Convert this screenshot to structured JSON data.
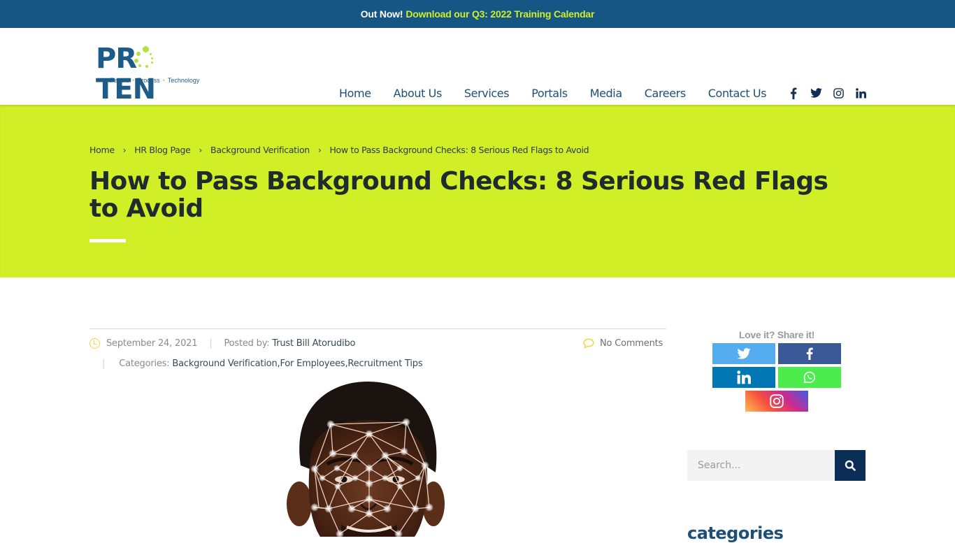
{
  "announcement": {
    "lead": "Out Now!",
    "link": "Download our Q3: 2022 Training Calendar"
  },
  "logo": {
    "wordmark_left": "PR",
    "wordmark_right": "TEN",
    "tagline": [
      "People",
      "Process",
      "Technology"
    ]
  },
  "nav": {
    "items": [
      {
        "label": "Home"
      },
      {
        "label": "About Us"
      },
      {
        "label": "Services"
      },
      {
        "label": "Portals"
      },
      {
        "label": "Media"
      },
      {
        "label": "Careers"
      },
      {
        "label": "Contact Us"
      }
    ],
    "social": [
      "facebook-icon",
      "twitter-icon",
      "instagram-icon",
      "linkedin-icon"
    ]
  },
  "hero": {
    "breadcrumb": [
      {
        "label": "Home"
      },
      {
        "label": "HR Blog Page"
      },
      {
        "label": "Background Verification"
      },
      {
        "label": "How to Pass Background Checks: 8 Serious Red Flags to Avoid"
      }
    ],
    "breadcrumb_separator": "›",
    "title": "How to Pass Background Checks: 8 Serious Red Flags to Avoid",
    "background_color": "#d1ef26"
  },
  "post_meta": {
    "date": "September 24, 2021",
    "posted_by_label": "Posted by:",
    "author": "Trust Bill Atorudibo",
    "comments": "No Comments",
    "categories_label": "Categories:",
    "categories": [
      "Background Verification",
      "For Employees",
      "Recruitment Tips"
    ],
    "category_separator": ", "
  },
  "image": {
    "alt": "Face with facial recognition mesh overlay"
  },
  "sidebar": {
    "share_label": "Love it? Share it!",
    "share_buttons": [
      {
        "network": "twitter",
        "color": "#55acee"
      },
      {
        "network": "facebook",
        "color": "#3b5998"
      },
      {
        "network": "linkedin",
        "color": "#0077b5"
      },
      {
        "network": "whatsapp",
        "color": "#4dec4d"
      },
      {
        "network": "instagram",
        "color": "#cc2a8e"
      }
    ],
    "search": {
      "placeholder": "Search...",
      "value": ""
    },
    "categories_heading": "categories"
  },
  "colors": {
    "topbar": "#155685",
    "accent_lime": "#d1ef26",
    "nav_text": "#1d4f78",
    "search_button": "#0b2e57"
  }
}
